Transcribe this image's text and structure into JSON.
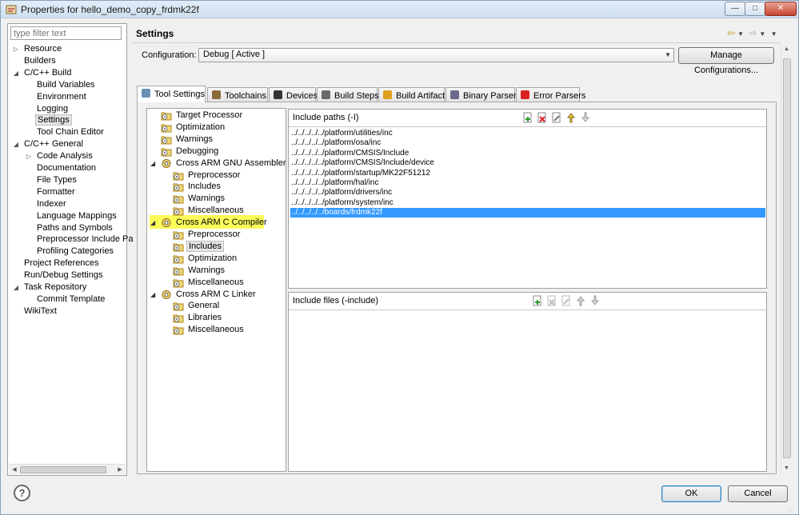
{
  "window": {
    "title": "Properties for hello_demo_copy_frdmk22f",
    "min_label": "—",
    "max_label": "□",
    "close_label": "✕"
  },
  "left_pane": {
    "filter_placeholder": "type filter text",
    "items": [
      {
        "label": "Resource",
        "expander": "▷"
      },
      {
        "label": "Builders",
        "expander": ""
      },
      {
        "label": "C/C++ Build",
        "expander": "◢"
      },
      {
        "label": "Build Variables",
        "expander": ""
      },
      {
        "label": "Environment",
        "expander": ""
      },
      {
        "label": "Logging",
        "expander": ""
      },
      {
        "label": "Settings",
        "expander": "",
        "selected": true
      },
      {
        "label": "Tool Chain Editor",
        "expander": ""
      },
      {
        "label": "C/C++ General",
        "expander": "◢"
      },
      {
        "label": "Code Analysis",
        "expander": "▷"
      },
      {
        "label": "Documentation",
        "expander": ""
      },
      {
        "label": "File Types",
        "expander": ""
      },
      {
        "label": "Formatter",
        "expander": ""
      },
      {
        "label": "Indexer",
        "expander": ""
      },
      {
        "label": "Language Mappings",
        "expander": ""
      },
      {
        "label": "Paths and Symbols",
        "expander": ""
      },
      {
        "label": "Preprocessor Include Pa",
        "expander": ""
      },
      {
        "label": "Profiling Categories",
        "expander": ""
      },
      {
        "label": "Project References",
        "expander": ""
      },
      {
        "label": "Run/Debug Settings",
        "expander": ""
      },
      {
        "label": "Task Repository",
        "expander": "◢"
      },
      {
        "label": "Commit Template",
        "expander": ""
      },
      {
        "label": "WikiText",
        "expander": ""
      }
    ]
  },
  "settings": {
    "title": "Settings",
    "config_label": "Configuration:",
    "config_value": "Debug  [ Active ]",
    "manage_button": "Manage Configurations..."
  },
  "tabs": [
    {
      "label": "Tool Settings",
      "active": true
    },
    {
      "label": "Toolchains"
    },
    {
      "label": "Devices"
    },
    {
      "label": "Build Steps"
    },
    {
      "label": "Build Artifact"
    },
    {
      "label": "Binary Parsers"
    },
    {
      "label": "Error Parsers"
    }
  ],
  "tool_tree": [
    {
      "label": "Target Processor",
      "expander": ""
    },
    {
      "label": "Optimization",
      "expander": ""
    },
    {
      "label": "Warnings",
      "expander": ""
    },
    {
      "label": "Debugging",
      "expander": ""
    },
    {
      "label": "Cross ARM GNU Assembler",
      "expander": "◢"
    },
    {
      "label": "Preprocessor",
      "expander": ""
    },
    {
      "label": "Includes",
      "expander": ""
    },
    {
      "label": "Warnings",
      "expander": ""
    },
    {
      "label": "Miscellaneous",
      "expander": ""
    },
    {
      "label": "Cross ARM C Compiler",
      "expander": "◢"
    },
    {
      "label": "Preprocessor",
      "expander": ""
    },
    {
      "label": "Includes",
      "expander": "",
      "selected": true
    },
    {
      "label": "Optimization",
      "expander": ""
    },
    {
      "label": "Warnings",
      "expander": ""
    },
    {
      "label": "Miscellaneous",
      "expander": ""
    },
    {
      "label": "Cross ARM C Linker",
      "expander": "◢"
    },
    {
      "label": "General",
      "expander": ""
    },
    {
      "label": "Libraries",
      "expander": ""
    },
    {
      "label": "Miscellaneous",
      "expander": ""
    }
  ],
  "include_paths": {
    "title": "Include paths (-I)",
    "items": [
      "../../../../../platform/utilities/inc",
      "../../../../../platform/osa/inc",
      "../../../../../platform/CMSIS/Include",
      "../../../../../platform/CMSIS/Include/device",
      "../../../../../platform/startup/MK22F51212",
      "../../../../../platform/hal/inc",
      "../../../../../platform/drivers/inc",
      "../../../../../platform/system/inc",
      "../../../../../boards/frdmk22f"
    ]
  },
  "include_files": {
    "title": "Include files (-include)"
  },
  "footer": {
    "help_label": "?",
    "ok_label": "OK",
    "cancel_label": "Cancel"
  },
  "colors": {
    "highlight": "#fbfb5a",
    "selection": "#3399ff"
  }
}
